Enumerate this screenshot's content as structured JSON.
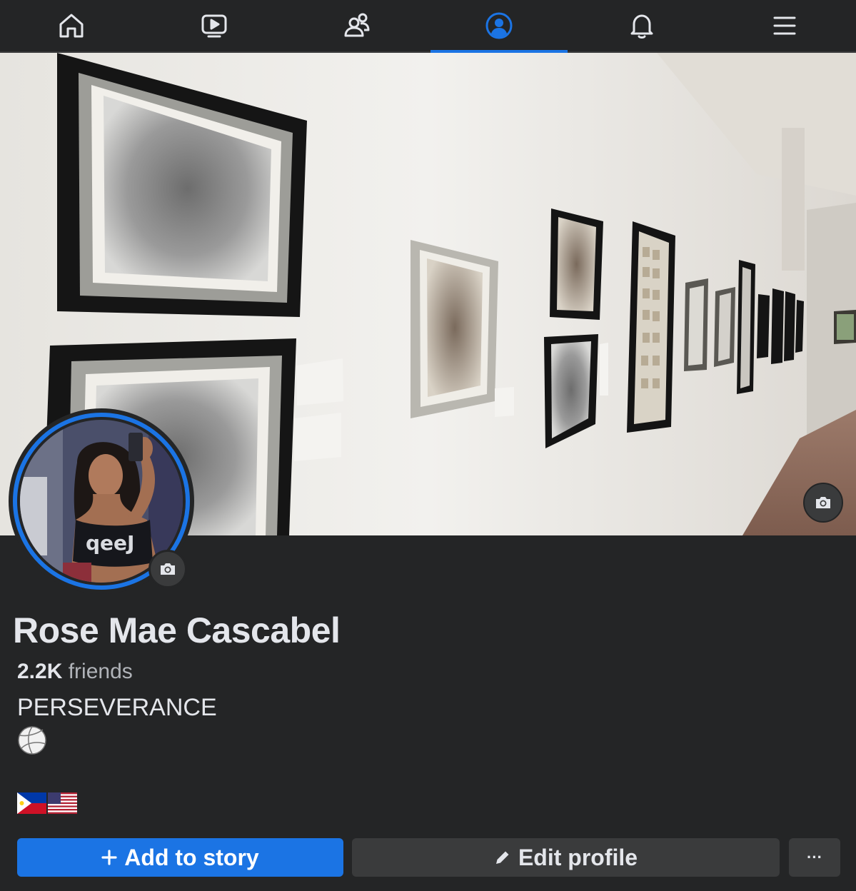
{
  "nav": {
    "tabs": [
      {
        "icon": "home-icon",
        "active": false
      },
      {
        "icon": "video-icon",
        "active": false
      },
      {
        "icon": "friends-icon",
        "active": false
      },
      {
        "icon": "profile-icon",
        "active": true
      },
      {
        "icon": "bell-icon",
        "active": false
      },
      {
        "icon": "menu-icon",
        "active": false
      }
    ],
    "accent_color": "#1b74e4"
  },
  "profile": {
    "name": "Rose Mae Cascabel",
    "friends_count": "2.2K",
    "friends_label": "friends",
    "bio": "PERSEVERANCE",
    "bio_emoji": "volleyball",
    "flags": [
      "Philippines",
      "United States"
    ]
  },
  "actions": {
    "add_story_label": "Add to story",
    "edit_profile_label": "Edit profile",
    "more_label": "···"
  },
  "colors": {
    "background": "#242526",
    "button_secondary": "#3a3b3c",
    "primary_button": "#1b74e4"
  }
}
